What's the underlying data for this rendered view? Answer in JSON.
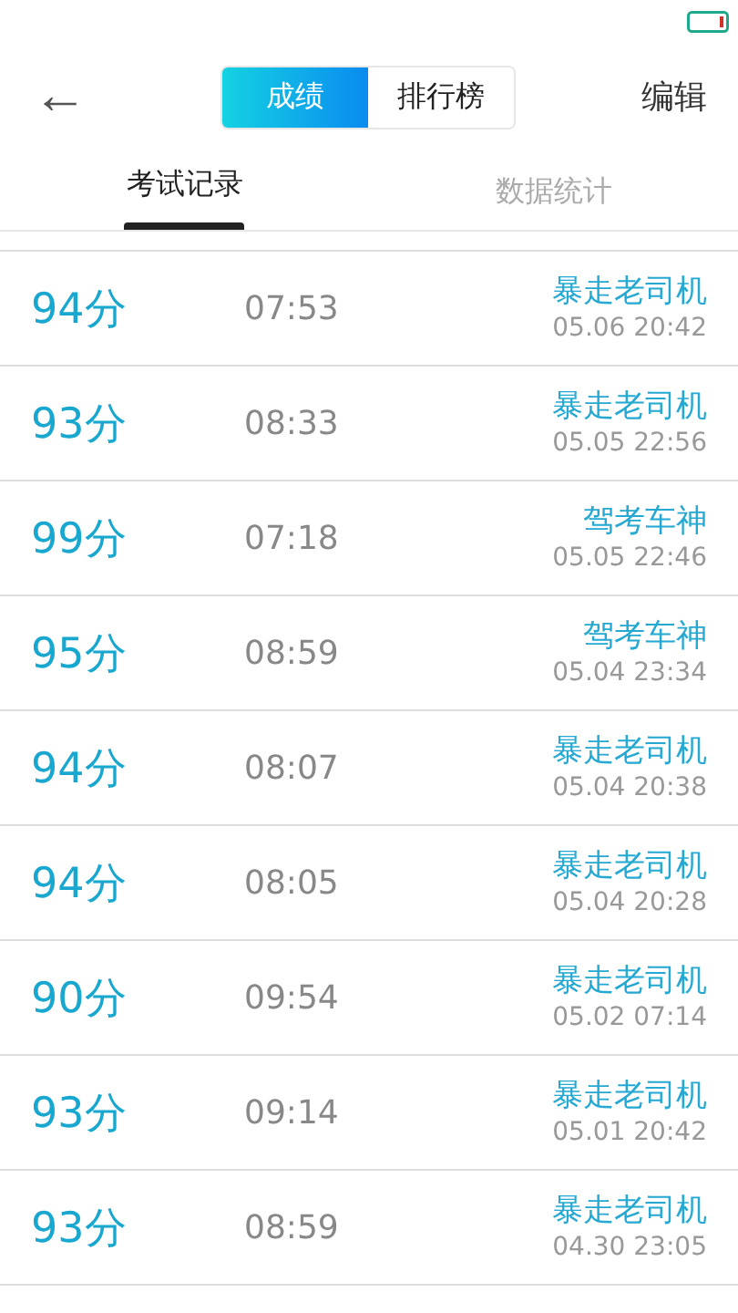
{
  "header": {
    "back": "←",
    "segments": [
      {
        "label": "成绩",
        "selected": true
      },
      {
        "label": "排行榜",
        "selected": false
      }
    ],
    "action": "编辑"
  },
  "tabs": [
    {
      "label": "考试记录",
      "selected": true
    },
    {
      "label": "数据统计",
      "selected": false
    }
  ],
  "records": [
    {
      "score": "94分",
      "duration": "07:53",
      "title": "暴走老司机",
      "date": "05.06  20:42"
    },
    {
      "score": "93分",
      "duration": "08:33",
      "title": "暴走老司机",
      "date": "05.05  22:56"
    },
    {
      "score": "99分",
      "duration": "07:18",
      "title": "驾考车神",
      "date": "05.05  22:46"
    },
    {
      "score": "95分",
      "duration": "08:59",
      "title": "驾考车神",
      "date": "05.04  23:34"
    },
    {
      "score": "94分",
      "duration": "08:07",
      "title": "暴走老司机",
      "date": "05.04  20:38"
    },
    {
      "score": "94分",
      "duration": "08:05",
      "title": "暴走老司机",
      "date": "05.04  20:28"
    },
    {
      "score": "90分",
      "duration": "09:54",
      "title": "暴走老司机",
      "date": "05.02  07:14"
    },
    {
      "score": "93分",
      "duration": "09:14",
      "title": "暴走老司机",
      "date": "05.01  20:42"
    },
    {
      "score": "93分",
      "duration": "08:59",
      "title": "暴走老司机",
      "date": "04.30  23:05"
    }
  ]
}
